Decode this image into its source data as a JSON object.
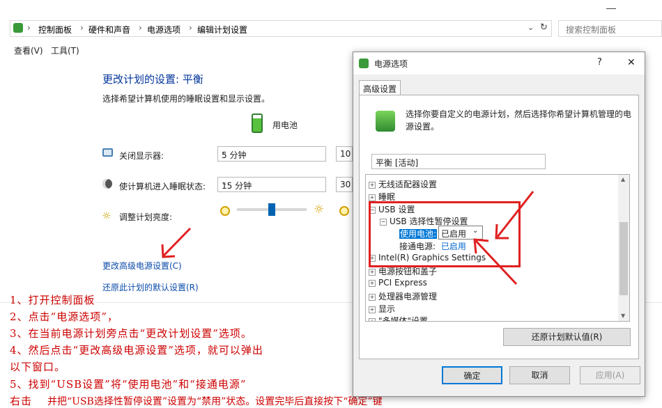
{
  "breadcrumb": [
    "控制面板",
    "硬件和声音",
    "电源选项",
    "编辑计划设置"
  ],
  "search_placeholder": "搜索控制面板",
  "menu": [
    "查看(V)",
    "工具(T)"
  ],
  "page": {
    "title": "更改计划的设置: 平衡",
    "subtitle": "选择希望计算机使用的睡眠设置和显示设置。",
    "battery_header": "用电池",
    "display_label": "关闭显示器:",
    "display_value": "5 分钟",
    "display_value2": "10",
    "sleep_label": "使计算机进入睡眠状态:",
    "sleep_value": "15 分钟",
    "sleep_value2": "30",
    "brightness_label": "调整计划亮度:",
    "brightness_level": 0.5,
    "link_advanced": "更改高级电源设置(C)",
    "link_restore": "还原此计划的默认设置(R)"
  },
  "notes": [
    "1、打开控制面板",
    "2、点击“电源选项”，",
    "3、在当前电源计划旁点击“更改计划设置”选项。",
    "4、然后点击“更改高级电源设置”选项，就可以弹出",
    "以下窗口。",
    "5、找到“USB设置”将“使用电池”和“接通电源”",
    "右击",
    "并把“USB选择性暂停设置”设置为“禁用”状态。设置完毕后直接按下“确定”键"
  ],
  "dialog": {
    "title": "电源选项",
    "help": "?",
    "close": "✕",
    "tab": "高级设置",
    "desc": "选择你要自定义的电源计划，然后选择你希望计算机管理的电源设置。",
    "plan": "平衡 [活动]",
    "tree": {
      "wireless": "无线适配器设置",
      "sleep": "睡眠",
      "usb": "USB 设置",
      "usb_suspend": "USB 选择性暂停设置",
      "battery_label": "使用电池:",
      "battery_value": "已启用",
      "plugged_label": "接通电源:",
      "plugged_value": "已启用",
      "intel": "Intel(R) Graphics Settings",
      "power_buttons": "电源按钮和盖子",
      "pci": "PCI Express",
      "processor": "处理器电源管理",
      "display": "显示",
      "multimedia": "\"多媒体\"设置"
    },
    "restore_button": "还原计划默认值(R)",
    "ok": "确定",
    "cancel": "取消",
    "apply": "应用(A)"
  },
  "colors": {
    "annotation": "#cc0000",
    "link": "#0a4aa8",
    "title": "#003399",
    "selection": "#0078d7"
  }
}
